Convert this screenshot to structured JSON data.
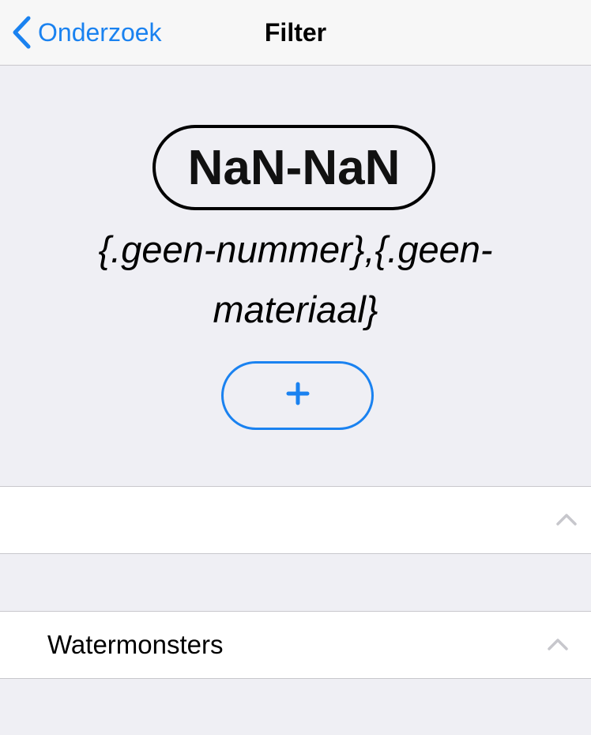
{
  "navbar": {
    "back_label": "Onderzoek",
    "title": "Filter"
  },
  "header": {
    "code": "NaN-NaN",
    "subtitle": "{.geen-nummer},{.geen-materiaal}"
  },
  "add_button": {
    "icon": "plus-icon"
  },
  "sections": [
    {
      "label": "",
      "icon": "chevron-up-icon"
    },
    {
      "label": "Watermonsters",
      "icon": "chevron-up-icon"
    }
  ],
  "colors": {
    "accent": "#1a82f0",
    "background": "#efeff4",
    "navbar": "#f7f7f7",
    "separator": "#c8c7cc",
    "chevron": "#c7c7cc"
  }
}
